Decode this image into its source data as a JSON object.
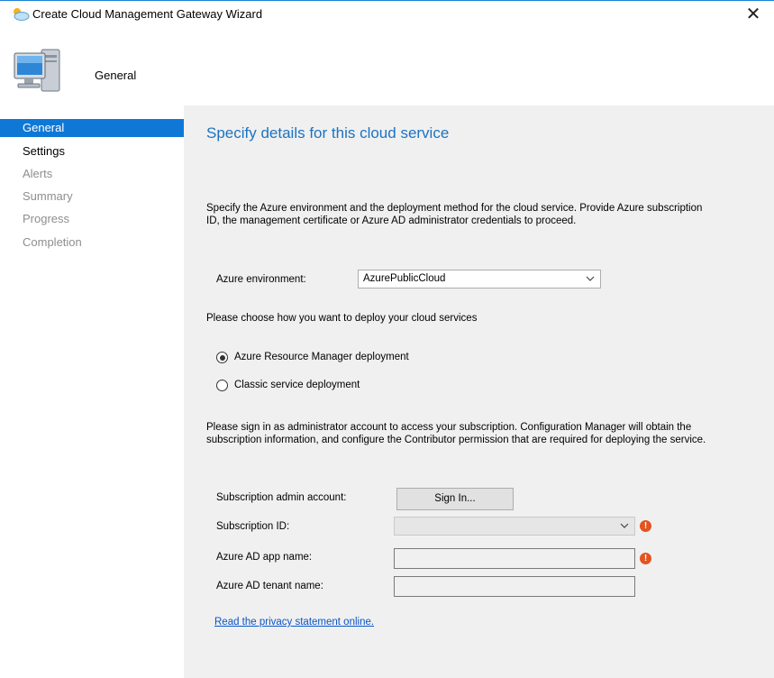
{
  "window": {
    "title": "Create Cloud Management Gateway Wizard",
    "close_glyph": "✕"
  },
  "header": {
    "title": "General"
  },
  "nav": {
    "items": [
      {
        "label": "General"
      },
      {
        "label": "Settings"
      },
      {
        "label": "Alerts"
      },
      {
        "label": "Summary"
      },
      {
        "label": "Progress"
      },
      {
        "label": "Completion"
      }
    ]
  },
  "page": {
    "heading": "Specify details for this cloud service",
    "intro": "Specify the Azure environment and the deployment method for the cloud service. Provide Azure subscription ID, the management certificate or Azure AD administrator credentials to proceed.",
    "azure_env_label": "Azure environment:",
    "azure_env_value": "AzurePublicCloud",
    "deploy_prompt": "Please choose how you want to deploy your cloud services",
    "radio_arm": "Azure Resource Manager deployment",
    "radio_classic": "Classic service deployment",
    "selected_deployment": "Azure Resource Manager deployment",
    "signin_text": "Please sign in as administrator account to access your subscription. Configuration Manager will obtain the subscription information, and configure the Contributor permission that are required for deploying the service.",
    "sub_admin_label": "Subscription admin account:",
    "signin_button": "Sign In...",
    "sub_id_label": "Subscription ID:",
    "sub_id_value": "",
    "app_name_label": "Azure AD app name:",
    "app_name_value": "",
    "tenant_label": "Azure AD tenant name:",
    "tenant_value": "",
    "error_glyph": "!",
    "privacy_link": "Read the privacy statement online."
  },
  "colors": {
    "accent": "#0f78d7",
    "heading": "#1d73c0",
    "error": "#e25420",
    "link": "#0b56c4"
  },
  "icons": [
    "cloud-app-icon",
    "computer-icon",
    "chevron-down-icon",
    "error-icon",
    "close-icon"
  ]
}
